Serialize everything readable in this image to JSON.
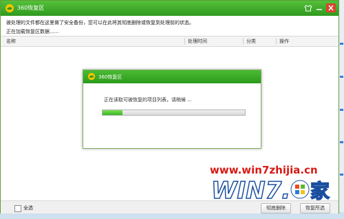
{
  "window": {
    "title": "360恢复区"
  },
  "info": {
    "line1": "被处理的文件都在这里做了安全备份，您可以在此将其彻底删除或恢复到处理前的状态。",
    "line2": "正在加载恢复区数据......"
  },
  "table": {
    "columns": [
      "名称",
      "处理时间",
      "分类",
      "操作"
    ]
  },
  "footer": {
    "select_all": "全选",
    "delete_label": "彻底删除",
    "restore_label": "恢复所选"
  },
  "dialog": {
    "title": "360恢复区",
    "message": "正在读取可被恢复的项目列表，请稍候 ...",
    "progress": 0.14
  },
  "watermark": {
    "url": "www.win7zhijia.cn",
    "logo_text": "WIN7家"
  },
  "colors": {
    "titlebar": "#3aa62a",
    "progress": "#4cc836",
    "watermark": "#d81a14"
  }
}
